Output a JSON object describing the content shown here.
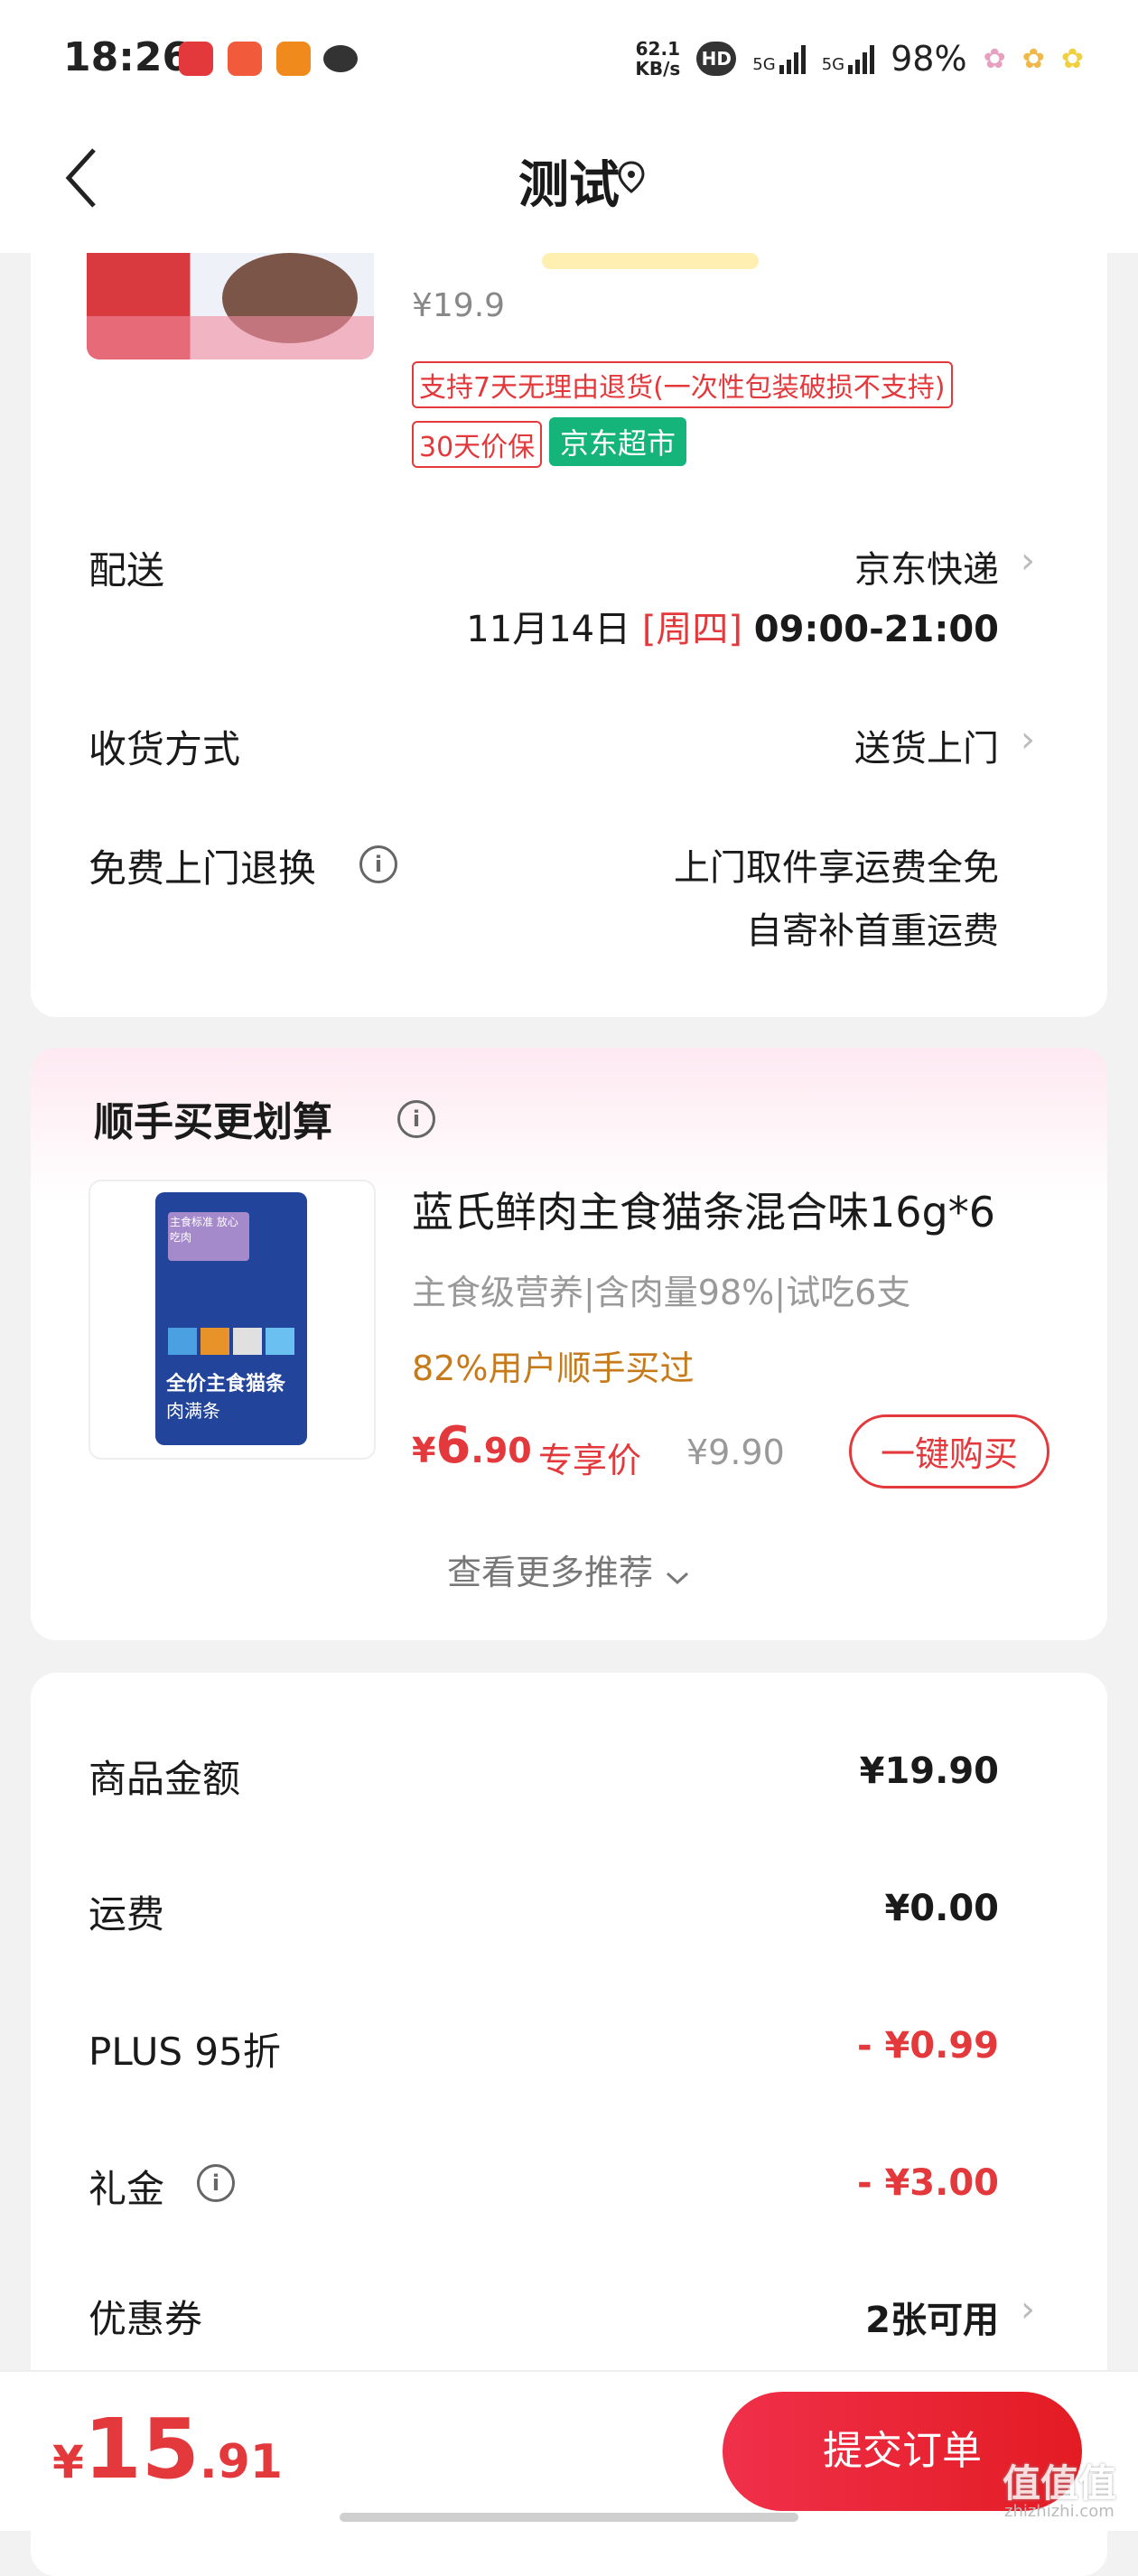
{
  "status_bar": {
    "time": "18:26",
    "net_speed_value": "62.1",
    "net_speed_unit": "KB/s",
    "hd": "HD",
    "sim1": "5G",
    "sim2": "5G",
    "battery": "98%"
  },
  "header": {
    "title": "测试"
  },
  "product": {
    "old_price": "¥19.9",
    "tag_return": "支持7天无理由退货(一次性包装破损不支持)",
    "tag_price_protect": "30天价保",
    "tag_store": "京东超市"
  },
  "delivery": {
    "label": "配送",
    "carrier": "京东快递",
    "date": "11月14日",
    "weekday": "[周四]",
    "time_window": "09:00-21:00"
  },
  "receive": {
    "label": "收货方式",
    "value": "送货上门"
  },
  "free_return": {
    "label": "免费上门退换",
    "line1": "上门取件享运费全免",
    "line2": "自寄补首重运费"
  },
  "recommend": {
    "title": "顺手买更划算",
    "product_name": "蓝氏鲜肉主食猫条混合味16g*6",
    "subtitle": "主食级营养|含肉量98%|试吃6支",
    "hint": "82%用户顺手买过",
    "price_symbol": "¥",
    "price_int": "6",
    "price_dec": ".90",
    "exclusive_label": "专享价",
    "orig_price": "¥9.90",
    "buy_button": "一键购买",
    "more": "查看更多推荐",
    "bag_text_top": "主食标准 放心吃肉",
    "bag_text_main": "全价主食猫条",
    "bag_text_sub": "肉满条"
  },
  "summary": {
    "rows": [
      {
        "label": "商品金额",
        "value": "¥19.90"
      },
      {
        "label": "运费",
        "value": "¥0.00"
      },
      {
        "label": "PLUS 95折",
        "value": "- ¥0.99"
      },
      {
        "label": "礼金",
        "value": "- ¥3.00"
      },
      {
        "label": "优惠券",
        "value": "2张可用"
      }
    ]
  },
  "bottom": {
    "currency": "¥",
    "total_int": "15",
    "total_dec": ".91",
    "submit": "提交订单",
    "watermark": "值值值",
    "watermark_sub": "zhizhizhi.com"
  },
  "colors": {
    "accent": "#e4393c",
    "jd_green": "#14b47a",
    "hint_orange": "#c77a1a"
  }
}
